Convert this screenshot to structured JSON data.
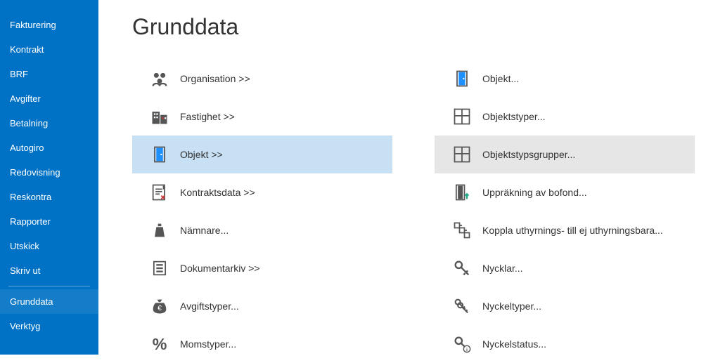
{
  "sidebar": {
    "items": [
      {
        "label": "Fakturering"
      },
      {
        "label": "Kontrakt"
      },
      {
        "label": "BRF"
      },
      {
        "label": "Avgifter"
      },
      {
        "label": "Betalning"
      },
      {
        "label": "Autogiro"
      },
      {
        "label": "Redovisning"
      },
      {
        "label": "Reskontra"
      },
      {
        "label": "Rapporter"
      },
      {
        "label": "Utskick"
      },
      {
        "label": "Skriv ut"
      }
    ],
    "bottom": [
      {
        "label": "Grunddata"
      },
      {
        "label": "Verktyg"
      }
    ]
  },
  "page": {
    "title": "Grunddata"
  },
  "grid": {
    "left": [
      {
        "label": "Organisation >>",
        "icon": "group"
      },
      {
        "label": "Fastighet >>",
        "icon": "buildings"
      },
      {
        "label": "Objekt >>",
        "icon": "door",
        "selected": true
      },
      {
        "label": "Kontraktsdata >>",
        "icon": "contract"
      },
      {
        "label": "Nämnare...",
        "icon": "weight"
      },
      {
        "label": "Dokumentarkiv >>",
        "icon": "archive"
      },
      {
        "label": "Avgiftstyper...",
        "icon": "moneybag"
      },
      {
        "label": "Momstyper...",
        "icon": "percent"
      }
    ],
    "right": [
      {
        "label": "Objekt...",
        "icon": "door-blue"
      },
      {
        "label": "Objektstyper...",
        "icon": "floorplan"
      },
      {
        "label": "Objektstypsgrupper...",
        "icon": "floorplan",
        "hover": true
      },
      {
        "label": "Uppräkning av bofond...",
        "icon": "door-up"
      },
      {
        "label": "Koppla uthyrnings- till ej uthyrningsbara...",
        "icon": "link"
      },
      {
        "label": "Nycklar...",
        "icon": "key"
      },
      {
        "label": "Nyckeltyper...",
        "icon": "keys"
      },
      {
        "label": "Nyckelstatus...",
        "icon": "key-info"
      }
    ]
  }
}
